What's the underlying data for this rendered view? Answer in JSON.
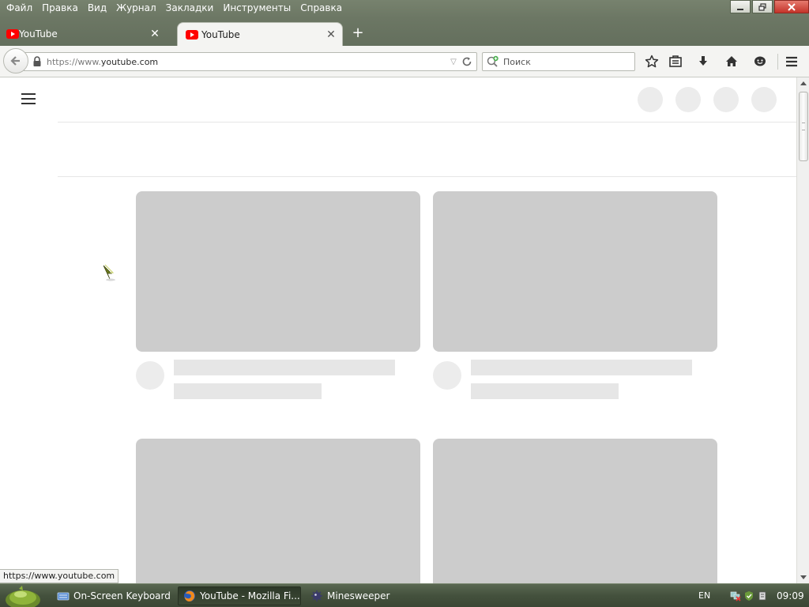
{
  "menubar": {
    "items": [
      "Файл",
      "Правка",
      "Вид",
      "Журнал",
      "Закладки",
      "Инструменты",
      "Справка"
    ]
  },
  "tabs": [
    {
      "title": "YouTube",
      "active": false,
      "icon": "youtube-icon"
    },
    {
      "title": "YouTube",
      "active": true,
      "icon": "youtube-icon"
    }
  ],
  "navbar": {
    "url_prefix": "https://www.",
    "url_domain": "youtube.com",
    "search_placeholder": "Поиск"
  },
  "status": {
    "hover_url": "https://www.youtube.com"
  },
  "taskbar": {
    "items": [
      {
        "label": "On-Screen Keyboard",
        "icon": "keyboard-icon",
        "active": false
      },
      {
        "label": "YouTube - Mozilla Fi...",
        "icon": "firefox-icon",
        "active": true
      },
      {
        "label": "Minesweeper",
        "icon": "minesweeper-icon",
        "active": false
      }
    ],
    "language": "EN",
    "clock": "09:09"
  },
  "colors": {
    "chrome": "#6c7764",
    "taskbar": "#44513d",
    "youtube_red": "#ff0000",
    "placeholder_dark": "#cccccc",
    "placeholder_light": "#e6e6e6"
  }
}
